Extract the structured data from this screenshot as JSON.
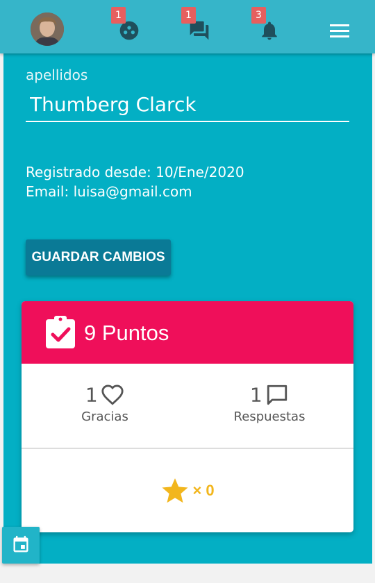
{
  "header": {
    "badges": {
      "groups": "1",
      "messages": "1",
      "notifications": "3"
    },
    "icons": [
      "avatar",
      "groups-icon",
      "forum-icon",
      "bell-icon",
      "menu-icon"
    ]
  },
  "profile": {
    "surname_label": "apellidos",
    "surname_value": "Thumberg Clarck",
    "registered": "Registrado desde: 10/Ene/2020",
    "email": "Email: luisa@gmail.com",
    "save_label": "GUARDAR CAMBIOS"
  },
  "points_card": {
    "title": "9 Puntos",
    "thanks_count": "1",
    "thanks_label": "Gracias",
    "answers_count": "1",
    "answers_label": "Respuestas",
    "stars_text": "× 0"
  },
  "colors": {
    "panel": "#03afc4",
    "header": "#36b5c9",
    "card_header": "#ef0f5a",
    "button": "#0a7a96",
    "badge": "#e65f5f",
    "star": "#f2b61d"
  }
}
